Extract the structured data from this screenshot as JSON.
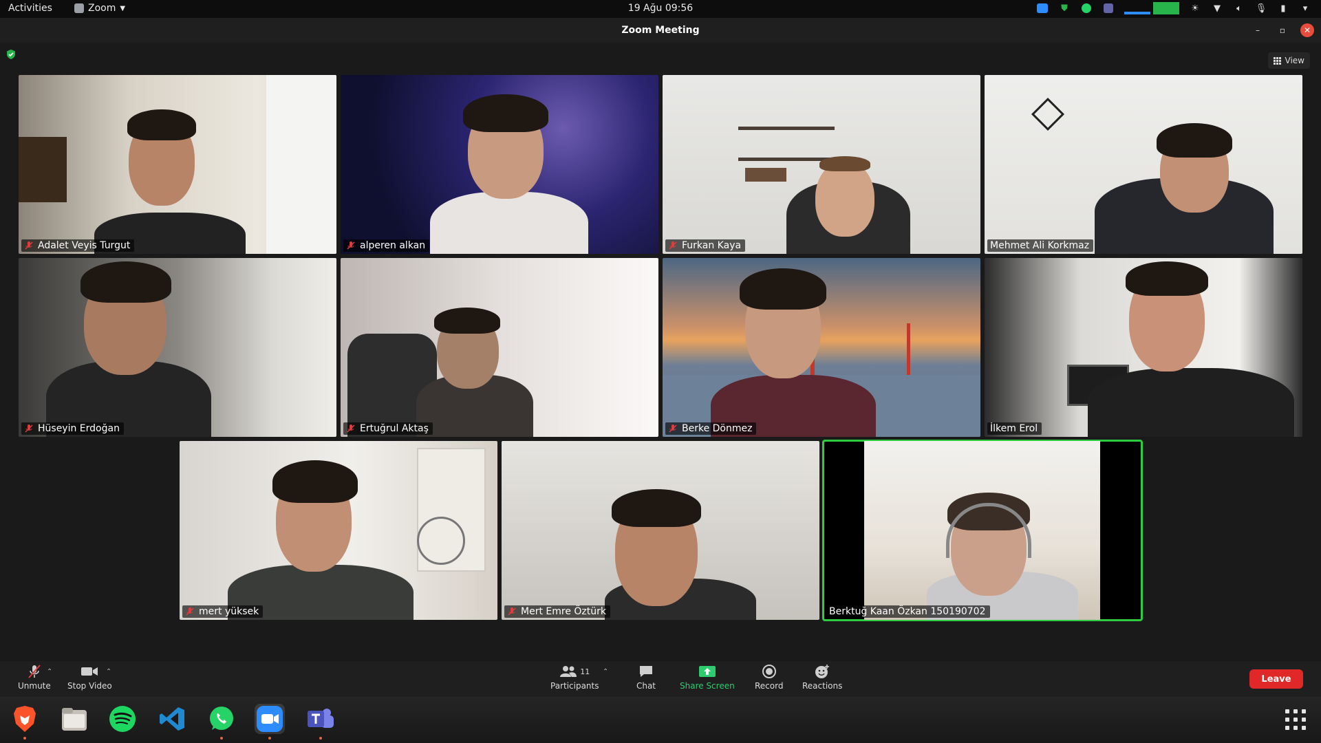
{
  "topbar": {
    "activities": "Activities",
    "app_name": "Zoom",
    "clock": "19 Ağu  09:56"
  },
  "window": {
    "title": "Zoom Meeting"
  },
  "meeting": {
    "view_label": "View",
    "participants": [
      {
        "name": "Adalet Veyis Turgut",
        "muted": true
      },
      {
        "name": "alperen alkan",
        "muted": true
      },
      {
        "name": "Furkan Kaya",
        "muted": true
      },
      {
        "name": "Mehmet Ali Korkmaz",
        "muted": false
      },
      {
        "name": "Hüseyin Erdoğan",
        "muted": true
      },
      {
        "name": "Ertuğrul Aktaş",
        "muted": true
      },
      {
        "name": "Berke Dönmez",
        "muted": true
      },
      {
        "name": "İlkem Erol",
        "muted": false
      },
      {
        "name": "mert yüksek",
        "muted": true
      },
      {
        "name": "Mert Emre Öztürk",
        "muted": true
      },
      {
        "name": "Berktuğ Kaan Özkan 150190702",
        "muted": false,
        "active_speaker": true
      }
    ]
  },
  "toolbar": {
    "unmute": "Unmute",
    "stop_video": "Stop Video",
    "participants_label": "Participants",
    "participants_count": "11",
    "chat": "Chat",
    "share_screen": "Share Screen",
    "record": "Record",
    "reactions": "Reactions",
    "leave": "Leave"
  },
  "dock": {
    "apps": [
      "brave-browser",
      "files",
      "spotify",
      "visual-studio-code",
      "whatsapp",
      "zoom",
      "microsoft-teams"
    ]
  },
  "colors": {
    "leave": "#e02828",
    "share": "#2ecc71",
    "active_speaker_border": "#2ecc40",
    "muted_mic": "#e23b3b"
  }
}
